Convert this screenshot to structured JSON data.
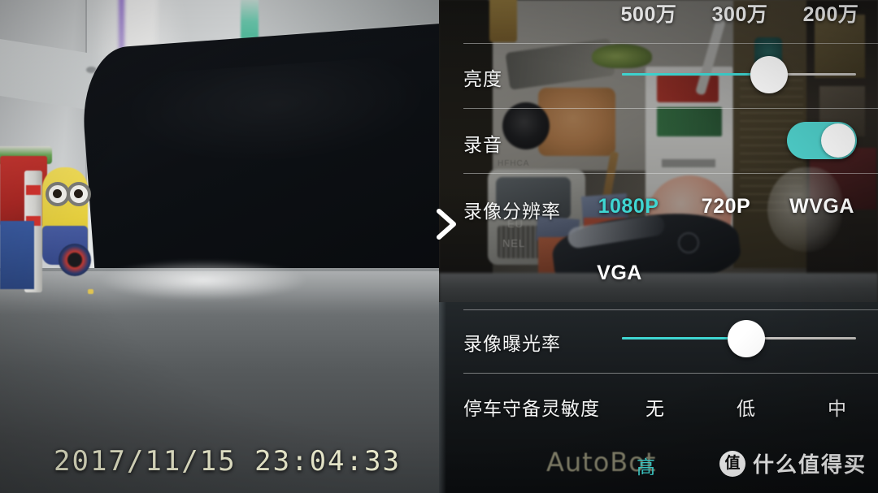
{
  "timestamp": "2017/11/15  23:04:33",
  "watermark": {
    "brand": "AutoBot",
    "logo_badge": "值",
    "logo_text": "什么值得买"
  },
  "accent_color": "#3fd6d2",
  "panel": {
    "photo_resolution": {
      "label": "",
      "options": [
        {
          "text": "500万",
          "selected": false
        },
        {
          "text": "300万",
          "selected": false
        },
        {
          "text": "200万",
          "selected": false
        }
      ]
    },
    "brightness": {
      "label": "亮度",
      "value_percent": 63
    },
    "audio_recording": {
      "label": "录音",
      "enabled": true
    },
    "video_resolution": {
      "label": "录像分辨率",
      "options": [
        {
          "text": "1080P",
          "selected": true
        },
        {
          "text": "720P",
          "selected": false
        },
        {
          "text": "WVGA",
          "selected": false
        },
        {
          "text": "VGA",
          "selected": false
        }
      ]
    },
    "video_exposure": {
      "label": "录像曝光率",
      "value_percent": 53
    },
    "parking_sensitivity": {
      "label": "停车守备灵敏度",
      "options": [
        {
          "text": "无",
          "selected": false
        },
        {
          "text": "低",
          "selected": false
        },
        {
          "text": "中",
          "selected": false
        },
        {
          "text": "高",
          "selected": true
        }
      ]
    }
  },
  "next_arrow": "chevron-right"
}
